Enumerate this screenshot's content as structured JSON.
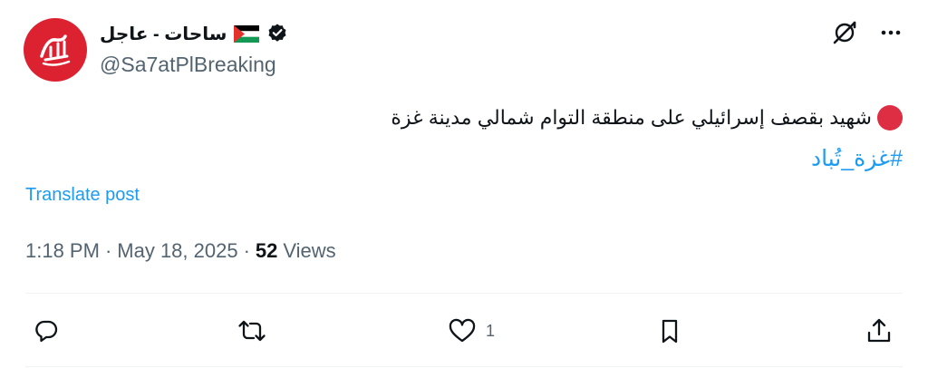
{
  "author": {
    "display_name": "ساحات - عاجل",
    "handle": "@Sa7atPlBreaking",
    "flag_icon": "palestine-flag-icon",
    "verified_icon": "verified-badge-icon",
    "avatar_color": "#dc2231"
  },
  "top_actions": {
    "grok_icon": "grok-icon",
    "more_icon": "more-icon"
  },
  "post": {
    "bullet_icon": "red-circle-icon",
    "bullet_color": "#dd2e44",
    "text": "شهيد بقصف إسرائيلي على منطقة التوام شمالي مدينة غزة",
    "hashtag": "#غزة_تُباد"
  },
  "translate_label": "Translate post",
  "meta": {
    "time": "1:18 PM",
    "separator1": "·",
    "date": "May 18, 2025",
    "separator2": "·",
    "views_count": "52",
    "views_label": "Views"
  },
  "actions": {
    "reply_icon": "reply-icon",
    "repost_icon": "repost-icon",
    "like_icon": "heart-icon",
    "like_count": "1",
    "bookmark_icon": "bookmark-icon",
    "share_icon": "share-icon"
  },
  "colors": {
    "accent": "#1d9bf0",
    "muted": "#536471",
    "text": "#0f1419"
  }
}
